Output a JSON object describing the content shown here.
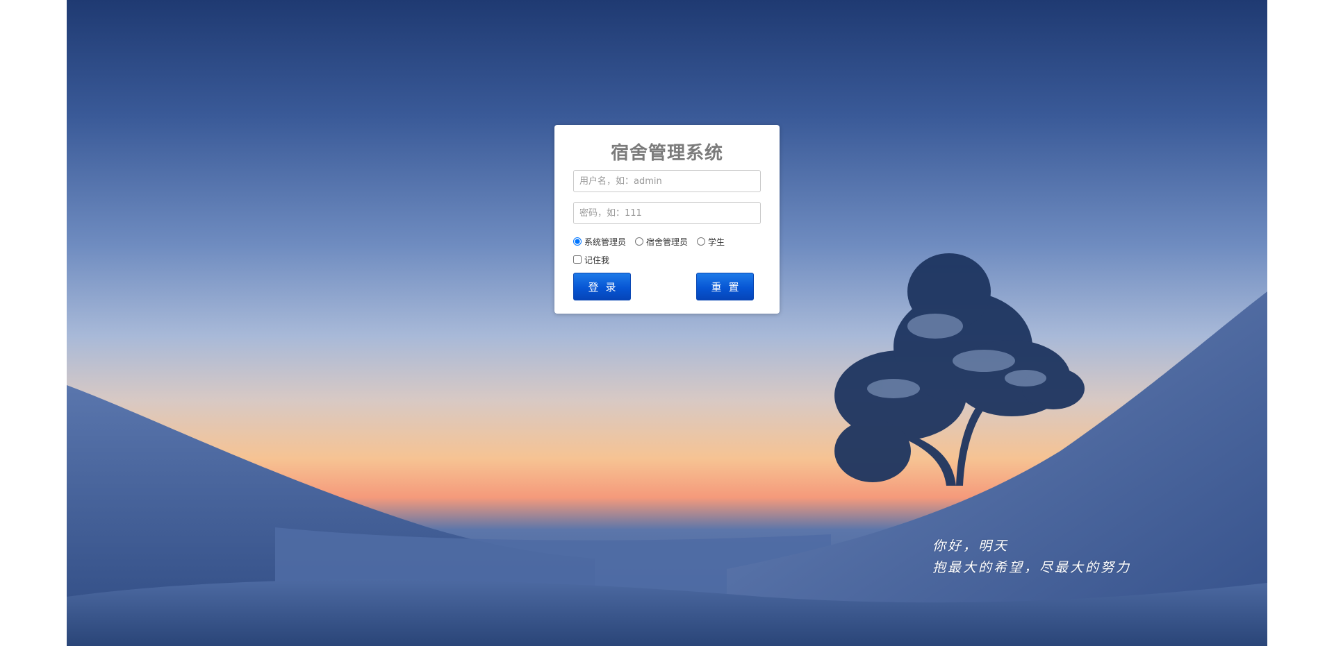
{
  "login": {
    "title": "宿舍管理系统",
    "username_placeholder": "用户名，如：admin",
    "password_placeholder": "密码，如：111",
    "roles": [
      {
        "label": "系统管理员",
        "selected": true
      },
      {
        "label": "宿舍管理员",
        "selected": false
      },
      {
        "label": "学生",
        "selected": false
      }
    ],
    "remember_label": "记住我",
    "remember_checked": false,
    "login_button": "登录",
    "reset_button": "重置"
  },
  "slogan": {
    "line1": "你好，明天",
    "line2": "抱最大的希望，尽最大的努力"
  },
  "colors": {
    "button_primary": "#0756d4",
    "title_gray": "#7b7b7b"
  }
}
